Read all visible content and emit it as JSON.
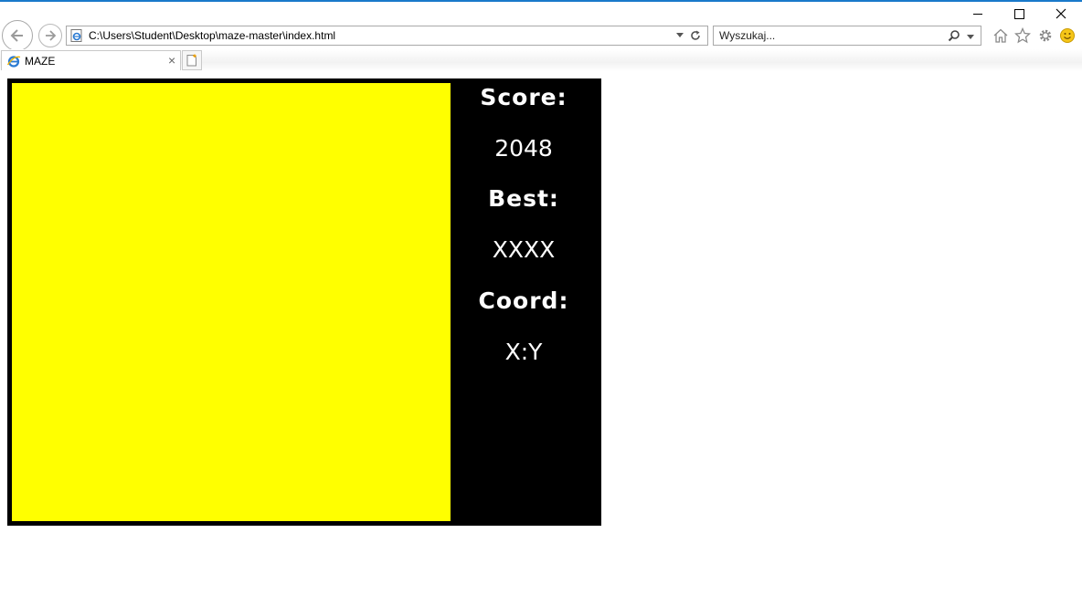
{
  "browser": {
    "address": "C:\\Users\\Student\\Desktop\\maze-master\\index.html",
    "search_placeholder": "Wyszukaj...",
    "tab_title": "MAZE"
  },
  "game": {
    "maze_color": "#ffff00",
    "score_label": "Score:",
    "score_value": "2048",
    "best_label": "Best:",
    "best_value": "XXXX",
    "coord_label": "Coord:",
    "coord_value": "X:Y"
  }
}
